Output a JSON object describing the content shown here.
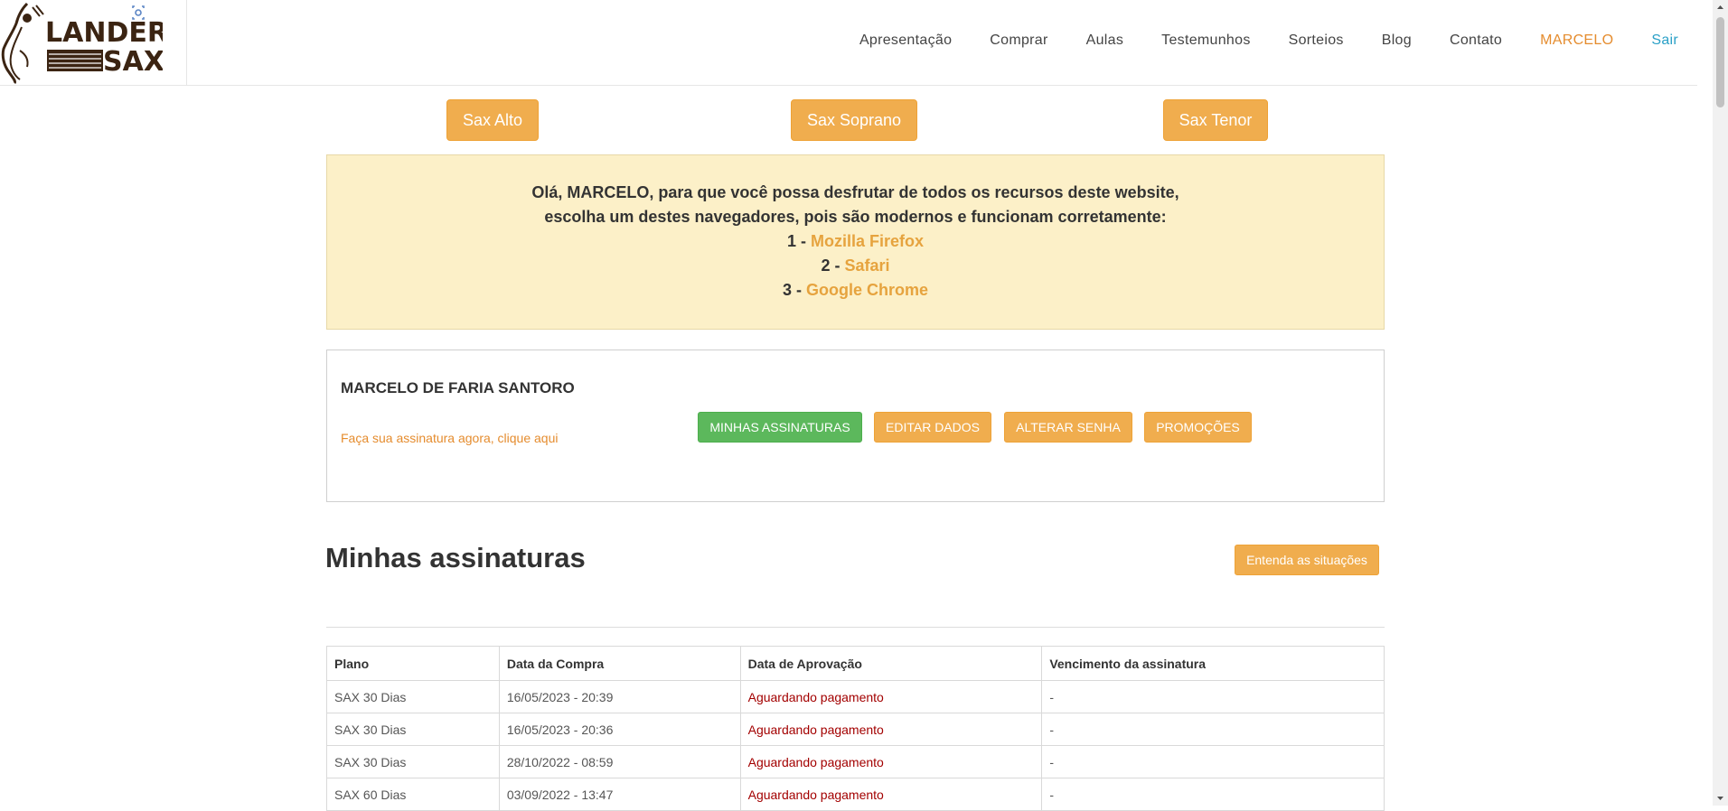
{
  "brand": {
    "logo_text_top": "LANDER",
    "logo_text_bottom": "SAX",
    "color_dark": "#3b2412",
    "color_accent": "#5b85c5"
  },
  "nav": {
    "items": [
      {
        "label": "Apresentação"
      },
      {
        "label": "Comprar"
      },
      {
        "label": "Aulas"
      },
      {
        "label": "Testemunhos"
      },
      {
        "label": "Sorteios"
      },
      {
        "label": "Blog"
      },
      {
        "label": "Contato"
      }
    ],
    "user": "MARCELO",
    "logout": "Sair"
  },
  "instruments": [
    {
      "label": "Sax Alto"
    },
    {
      "label": "Sax Soprano"
    },
    {
      "label": "Sax Tenor"
    }
  ],
  "alert": {
    "line1": "Olá, MARCELO, para que você possa desfrutar de todos os recursos deste website,",
    "line2": "escolha um destes navegadores, pois são modernos e funcionam corretamente:",
    "browsers": [
      {
        "number": "1 -",
        "name": "Mozilla Firefox"
      },
      {
        "number": "2 -",
        "name": "Safari"
      },
      {
        "number": "3 -",
        "name": "Google Chrome"
      }
    ]
  },
  "profile": {
    "name": "MARCELO DE FARIA SANTORO",
    "subscribe_link": "Faça sua assinatura agora, clique aqui",
    "buttons": [
      {
        "label": "MINHAS ASSINATURAS"
      },
      {
        "label": "EDITAR DADOS"
      },
      {
        "label": "ALTERAR SENHA"
      },
      {
        "label": "PROMOÇÕES"
      }
    ]
  },
  "section": {
    "title": "Minhas assinaturas",
    "explain_button": "Entenda as situações"
  },
  "table": {
    "headers": [
      "Plano",
      "Data da Compra",
      "Data de Aprovação",
      "Vencimento da assinatura"
    ],
    "rows": [
      [
        "SAX 30 Dias",
        "16/05/2023 - 20:39",
        "Aguardando pagamento",
        "-"
      ],
      [
        "SAX 30 Dias",
        "16/05/2023 - 20:36",
        "Aguardando pagamento",
        "-"
      ],
      [
        "SAX 30 Dias",
        "28/10/2022 - 08:59",
        "Aguardando pagamento",
        "-"
      ],
      [
        "SAX 60 Dias",
        "03/09/2022 - 13:47",
        "Aguardando pagamento",
        "-"
      ]
    ]
  },
  "colors": {
    "orange_button": "#f0ad4e",
    "green_button": "#5cb85c",
    "alert_background": "#fcf0c8",
    "status_pending": "#a30000",
    "user_link": "#e58c2e",
    "logout_link": "#2aa0c7"
  }
}
